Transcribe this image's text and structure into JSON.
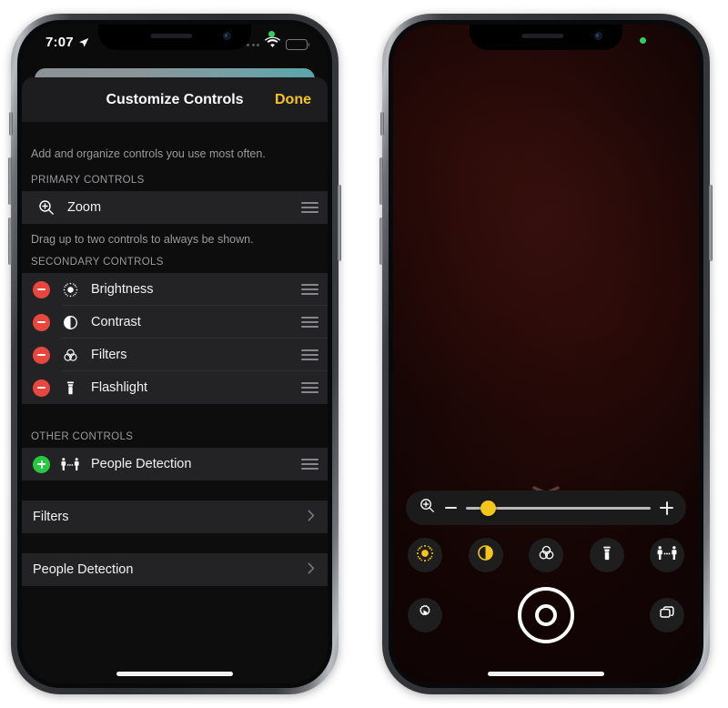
{
  "left_phone": {
    "status_bar": {
      "time": "7:07",
      "location_icon": "location-arrow-icon",
      "signal_icon": "cellular-dots-icon",
      "wifi_icon": "wifi-icon",
      "battery_icon": "battery-icon",
      "green_dot": "camera-in-use-indicator"
    },
    "sheet": {
      "title": "Customize Controls",
      "done_label": "Done",
      "intro_footnote": "Add and organize controls you use most often.",
      "sections": [
        {
          "header": "PRIMARY CONTROLS",
          "footnote": "Drag up to two controls to always be shown.",
          "rows": [
            {
              "label": "Zoom",
              "icon": "zoom-magnifier-icon",
              "badge": "none",
              "handle": "reorder-handle-icon"
            }
          ]
        },
        {
          "header": "SECONDARY CONTROLS",
          "footnote": "",
          "rows": [
            {
              "label": "Brightness",
              "icon": "brightness-sun-icon",
              "badge": "remove",
              "handle": "reorder-handle-icon"
            },
            {
              "label": "Contrast",
              "icon": "contrast-half-circle-icon",
              "badge": "remove",
              "handle": "reorder-handle-icon"
            },
            {
              "label": "Filters",
              "icon": "filters-venn-icon",
              "badge": "remove",
              "handle": "reorder-handle-icon"
            },
            {
              "label": "Flashlight",
              "icon": "flashlight-icon",
              "badge": "remove",
              "handle": "reorder-handle-icon"
            }
          ]
        },
        {
          "header": "OTHER CONTROLS",
          "footnote": "",
          "rows": [
            {
              "label": "People Detection",
              "icon": "people-detection-icon",
              "badge": "add",
              "handle": "reorder-handle-icon"
            }
          ]
        }
      ],
      "nav_rows": [
        {
          "label": "Filters",
          "chevron": "chevron-right-icon"
        },
        {
          "label": "People Detection",
          "chevron": "chevron-right-icon"
        }
      ]
    }
  },
  "right_phone": {
    "status_bar": {
      "green_dot": "camera-in-use-indicator"
    },
    "camera_view": {
      "description": "dark-camera-preview"
    },
    "controls": {
      "drag_handle": "chevron-down-handle-icon",
      "zoom_slider": {
        "left_icon": "zoom-magnifier-icon",
        "decrease_icon": "minus-icon",
        "increase_icon": "plus-icon",
        "value_percent": 12
      },
      "tool_buttons": [
        {
          "name": "brightness",
          "icon": "brightness-sun-icon",
          "active": true
        },
        {
          "name": "contrast",
          "icon": "contrast-half-circle-icon",
          "active": true
        },
        {
          "name": "filters",
          "icon": "filters-venn-icon",
          "active": false
        },
        {
          "name": "flashlight",
          "icon": "flashlight-icon",
          "active": false
        },
        {
          "name": "people-detection",
          "icon": "people-detection-icon",
          "active": false
        }
      ],
      "bottom_buttons": [
        {
          "name": "settings",
          "icon": "settings-gear-icon"
        },
        {
          "name": "shutter",
          "icon": "shutter-icon"
        },
        {
          "name": "multi-capture",
          "icon": "layers-icon"
        }
      ]
    }
  },
  "colors": {
    "accent_yellow": "#f5c421",
    "remove_red": "#e8473f",
    "add_green": "#28c940",
    "row_bg": "#232325",
    "sheet_bg": "#0d0d0e",
    "nav_bg": "#1d1d1f",
    "green_privacy_dot": "#30d158"
  }
}
